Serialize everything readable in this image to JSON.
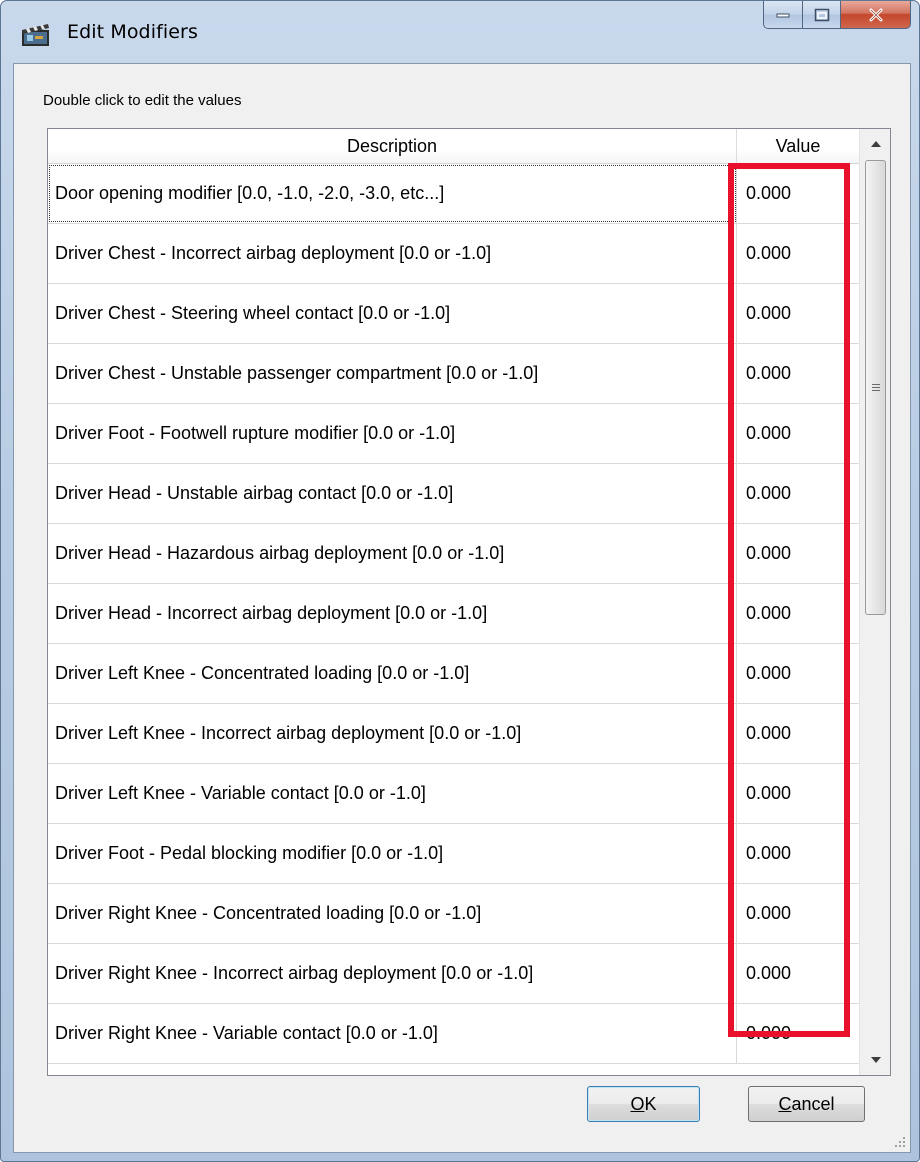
{
  "window": {
    "title": "Edit Modifiers",
    "app_icon": "film-clapper-icon",
    "accent_color": "#e8102a"
  },
  "dialog": {
    "hint": "Double click to edit the values"
  },
  "grid": {
    "columns": [
      "Description",
      "Value"
    ],
    "rows": [
      {
        "description": "Door opening modifier [0.0, -1.0, -2.0, -3.0, etc...]",
        "value": "0.000"
      },
      {
        "description": "Driver Chest - Incorrect airbag deployment [0.0 or -1.0]",
        "value": "0.000"
      },
      {
        "description": "Driver Chest - Steering wheel contact [0.0 or -1.0]",
        "value": "0.000"
      },
      {
        "description": "Driver Chest - Unstable passenger compartment [0.0 or -1.0]",
        "value": "0.000"
      },
      {
        "description": "Driver Foot - Footwell rupture modifier [0.0 or -1.0]",
        "value": "0.000"
      },
      {
        "description": "Driver Head - Unstable airbag contact [0.0 or -1.0]",
        "value": "0.000"
      },
      {
        "description": "Driver Head - Hazardous airbag deployment [0.0 or -1.0]",
        "value": "0.000"
      },
      {
        "description": "Driver Head - Incorrect airbag deployment [0.0 or -1.0]",
        "value": "0.000"
      },
      {
        "description": "Driver Left Knee - Concentrated loading [0.0 or -1.0]",
        "value": "0.000"
      },
      {
        "description": "Driver Left Knee - Incorrect airbag deployment [0.0 or -1.0]",
        "value": "0.000"
      },
      {
        "description": "Driver Left Knee - Variable contact [0.0 or -1.0]",
        "value": "0.000"
      },
      {
        "description": "Driver Foot - Pedal blocking modifier [0.0 or -1.0]",
        "value": "0.000"
      },
      {
        "description": "Driver Right Knee - Concentrated loading [0.0 or -1.0]",
        "value": "0.000"
      },
      {
        "description": "Driver Right Knee - Incorrect airbag deployment [0.0 or -1.0]",
        "value": "0.000"
      },
      {
        "description": "Driver Right Knee - Variable contact [0.0 or -1.0]",
        "value": "0.000"
      }
    ]
  },
  "buttons": {
    "ok": {
      "mnemonic": "O",
      "rest": "K"
    },
    "cancel": {
      "mnemonic": "C",
      "rest": "ancel"
    }
  }
}
